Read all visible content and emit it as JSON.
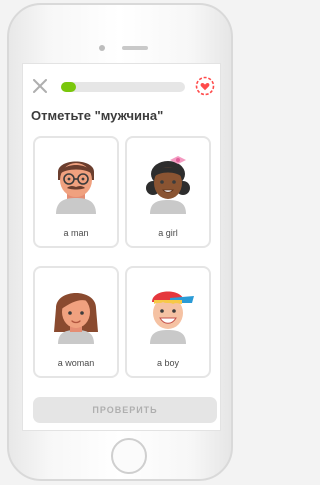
{
  "header": {
    "close_icon": "close-icon",
    "heart_icon": "heart-icon",
    "progress_fraction": 0.12,
    "progress_color": "#7ac70c"
  },
  "prompt": {
    "title": "Отметьте \"мужчина\""
  },
  "options": [
    {
      "label": "a man",
      "icon": "man-avatar-icon"
    },
    {
      "label": "a girl",
      "icon": "girl-avatar-icon"
    },
    {
      "label": "a woman",
      "icon": "woman-avatar-icon"
    },
    {
      "label": "a boy",
      "icon": "boy-avatar-icon"
    }
  ],
  "footer": {
    "check_label": "ПРОВЕРИТЬ"
  },
  "colors": {
    "accent": "#7ac70c",
    "heart": "#ff4b4b",
    "button_disabled": "#e5e5e5"
  }
}
